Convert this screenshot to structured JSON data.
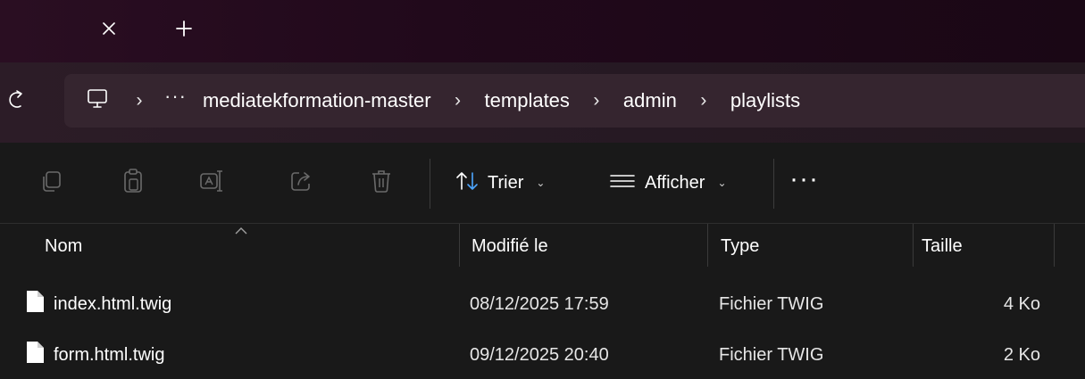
{
  "window": {
    "tab_close_icon": "close-icon",
    "new_tab_icon": "plus-icon"
  },
  "address_bar": {
    "device_icon": "this-pc-icon",
    "overflow": "···",
    "breadcrumbs": [
      "mediatekformation-master",
      "templates",
      "admin",
      "playlists"
    ]
  },
  "toolbar": {
    "icons": [
      "copy-icon",
      "paste-icon",
      "rename-icon",
      "share-icon",
      "delete-icon"
    ],
    "sort_label": "Trier",
    "view_label": "Afficher",
    "more_label": "···"
  },
  "columns": {
    "name": "Nom",
    "modified": "Modifié le",
    "type": "Type",
    "size": "Taille"
  },
  "files": [
    {
      "name": "index.html.twig",
      "modified": "08/12/2025 17:59",
      "type": "Fichier TWIG",
      "size": "4 Ko"
    },
    {
      "name": "form.html.twig",
      "modified": "09/12/2025 20:40",
      "type": "Fichier TWIG",
      "size": "2 Ko"
    }
  ],
  "colors": {
    "titlebar": "#21091b",
    "addressrow": "#2a1c26",
    "address_field": "#35252f",
    "content_bg": "#191919",
    "disabled_icon": "#6a6a6a"
  }
}
